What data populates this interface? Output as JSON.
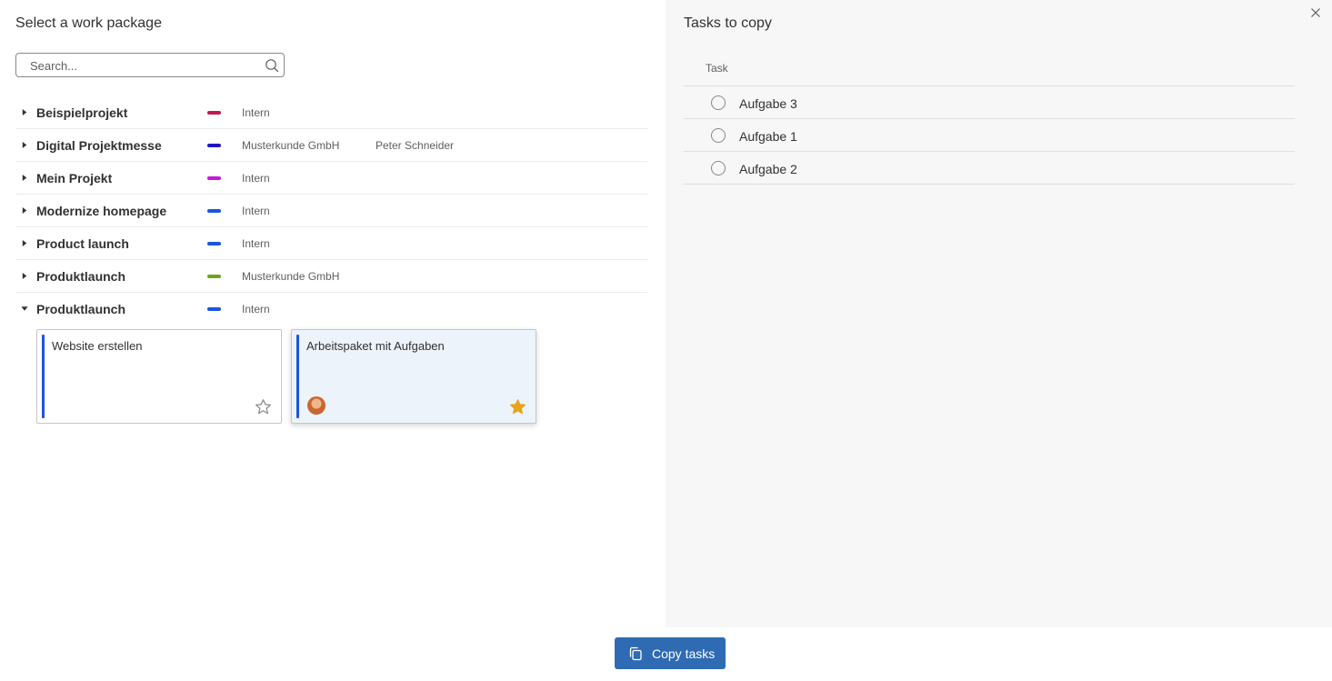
{
  "left_panel": {
    "title": "Select a work package",
    "search": {
      "placeholder": "Search...",
      "value": "",
      "icon": "search-icon"
    }
  },
  "projects": [
    {
      "name": "Beispielprojekt",
      "color": "#c4174f",
      "client": "Intern",
      "owner": "",
      "expanded": false
    },
    {
      "name": "Digital Projektmesse",
      "color": "#1f17c4",
      "client": "Musterkunde GmbH",
      "owner": "Peter Schneider",
      "expanded": false
    },
    {
      "name": "Mein Projekt",
      "color": "#c417d8",
      "client": "Intern",
      "owner": "",
      "expanded": false
    },
    {
      "name": "Modernize homepage",
      "color": "#1a56db",
      "client": "Intern",
      "owner": "",
      "expanded": false
    },
    {
      "name": "Product launch",
      "color": "#1a56db",
      "client": "Intern",
      "owner": "",
      "expanded": false
    },
    {
      "name": "Produktlaunch",
      "color": "#6ea51a",
      "client": "Musterkunde GmbH",
      "owner": "",
      "expanded": false
    },
    {
      "name": "Produktlaunch",
      "color": "#1a56db",
      "client": "Intern",
      "owner": "",
      "expanded": true
    }
  ],
  "work_packages": [
    {
      "title": "Website erstellen",
      "selected": false,
      "favorite": false,
      "has_avatar": false
    },
    {
      "title": "Arbeitspaket mit Aufgaben",
      "selected": true,
      "favorite": true,
      "has_avatar": true
    }
  ],
  "right_panel": {
    "title": "Tasks to copy",
    "column_header": "Task",
    "tasks": [
      {
        "label": "Aufgabe 3",
        "checked": false
      },
      {
        "label": "Aufgabe 1",
        "checked": false
      },
      {
        "label": "Aufgabe 2",
        "checked": false
      }
    ],
    "close_icon": "close-icon"
  },
  "footer": {
    "copy_label": "Copy tasks",
    "copy_icon": "copy-icon",
    "button_color": "#2f6bb3"
  },
  "colors": {
    "star_active": "#e8a317",
    "star_inactive": "#8a8886",
    "accent": "#1a56db"
  }
}
